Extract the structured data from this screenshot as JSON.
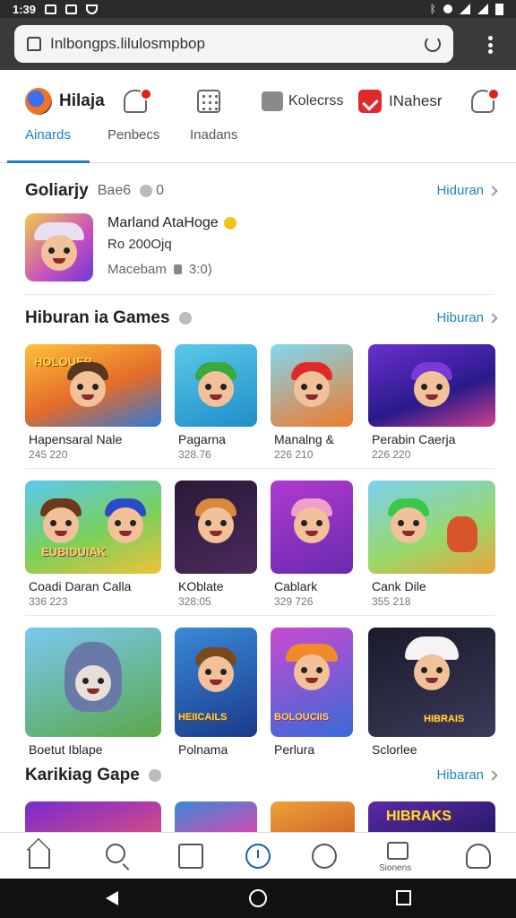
{
  "status_bar": {
    "time": "1:39"
  },
  "browser": {
    "url": "Inlbongps.lilulosmpbop"
  },
  "header": {
    "brand": "Hilaja",
    "shortcuts": [
      {
        "label": "Kolecrss",
        "icon": "box-icon"
      },
      {
        "label": "INahesr",
        "icon": "red-check-icon",
        "color": "#e0282e"
      }
    ],
    "tabs": [
      "Ainards",
      "Penbecs",
      "Inadans"
    ],
    "active_tab": "Ainards",
    "accent_color": "#1a7fc4"
  },
  "featured": {
    "title": "Goliarjy",
    "aux": "Bae6",
    "aux_count": "0",
    "link": "Hiduran",
    "item": {
      "title": "Marland AtaHoge",
      "subtitle": "Ro 200Ojq",
      "meta": "Macebam",
      "meta_value": "3:0)"
    }
  },
  "games_section": {
    "title": "Hiburan ia Games",
    "link": "Hiburan",
    "rows": [
      [
        {
          "name": "Hapensaral Nale",
          "sub": "245 220",
          "thumb_label": "HOLOUER"
        },
        {
          "name": "Pagarna",
          "sub": "328.76"
        },
        {
          "name": "Manalng &",
          "sub": "226 210"
        },
        {
          "name": "Perabin Caerja",
          "sub": "226 220"
        }
      ],
      [
        {
          "name": "Coadi Daran Calla",
          "sub": "336 223",
          "thumb_label": "EUBIDUIAK"
        },
        {
          "name": "KOblate",
          "sub": "328:05"
        },
        {
          "name": "Cablark",
          "sub": "329 726"
        },
        {
          "name": "Cank Dile",
          "sub": "355 218"
        }
      ],
      [
        {
          "name": "Boetut Iblape",
          "sub": ""
        },
        {
          "name": "Polnama",
          "sub": "",
          "thumb_label": "HEIICAILS"
        },
        {
          "name": "Perlura",
          "sub": "",
          "thumb_label": "BOLOUCIIS"
        },
        {
          "name": "Sclorlee",
          "sub": "",
          "thumb_label": "HIBRAIS"
        }
      ]
    ]
  },
  "next_section": {
    "title": "Karikiag Gape",
    "link": "Hibaran",
    "row_labels": [
      "",
      "",
      "",
      "HIBRAKS"
    ]
  },
  "bottom_nav": {
    "items": [
      {
        "name": "home-icon"
      },
      {
        "name": "search-icon"
      },
      {
        "name": "box-icon"
      },
      {
        "name": "clock-icon"
      },
      {
        "name": "heart-icon"
      },
      {
        "name": "store-icon",
        "label": "Sionens"
      },
      {
        "name": "user-icon"
      }
    ]
  }
}
